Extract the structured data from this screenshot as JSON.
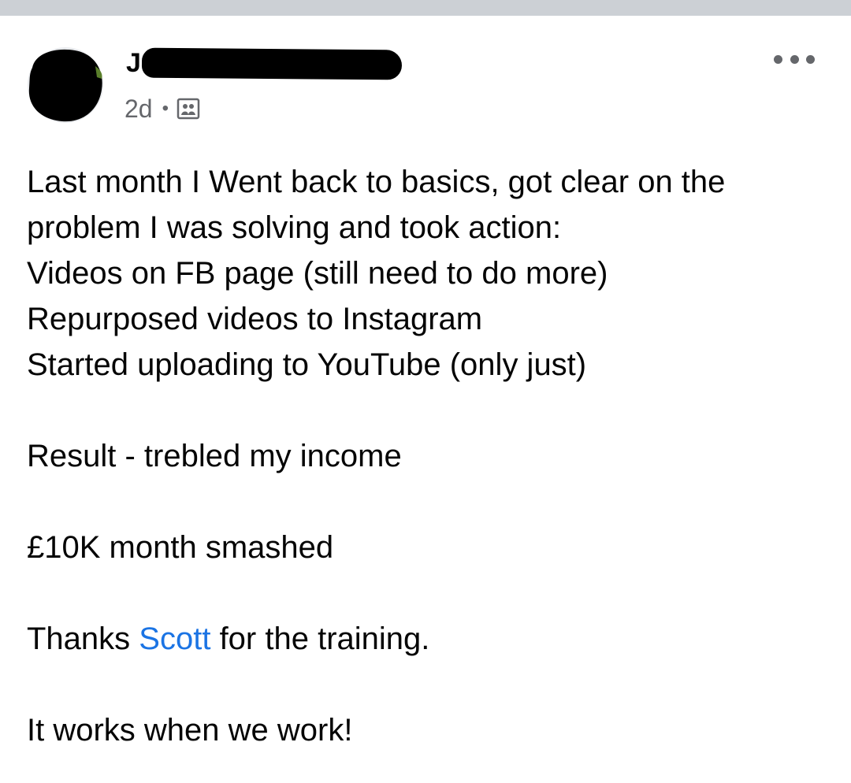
{
  "post": {
    "author_initial": "J",
    "timestamp": "2d",
    "separator": "•",
    "audience_icon": "group-privacy-icon",
    "more_icon": "more-options-icon",
    "body": {
      "lines_block1": [
        "Last month I Went back to basics, got clear on the",
        "problem I was solving and took action:",
        "Videos on FB page (still need to do more)",
        "Repurposed videos to Instagram",
        "Started uploading to YouTube (only just)"
      ],
      "result_line": "Result - trebled my income",
      "milestone_line": "£10K month smashed",
      "thanks_prefix": "Thanks ",
      "mention_name": "Scott",
      "thanks_suffix": " for the training.",
      "closing_line": "It works when we work!"
    }
  },
  "colors": {
    "divider": "#ccd0d5",
    "text": "#050505",
    "secondary_text": "#65676b",
    "mention": "#1b74e4",
    "redaction": "#000000"
  }
}
